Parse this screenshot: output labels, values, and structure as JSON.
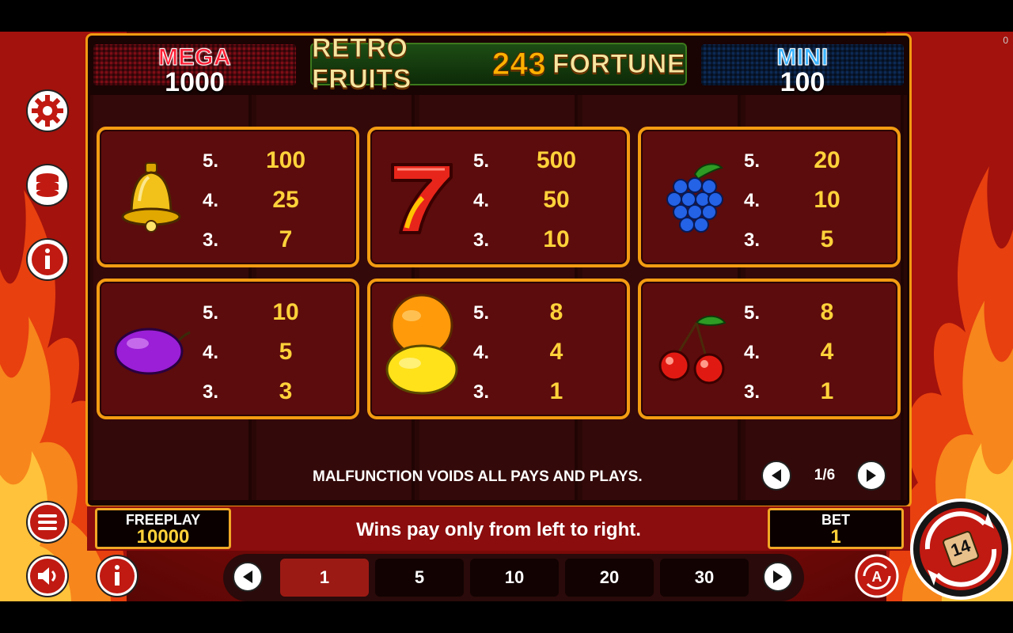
{
  "corner_counter": "0",
  "jackpots": {
    "mega": {
      "label": "MEGA",
      "value": "1000"
    },
    "mini": {
      "label": "MINI",
      "value": "100"
    }
  },
  "logo": {
    "part1": "RETRO FRUITS",
    "number": "243",
    "part2": "FORTUNE"
  },
  "paytable": [
    {
      "symbol": "bell-icon",
      "rows": [
        {
          "count": "5.",
          "pay": "100"
        },
        {
          "count": "4.",
          "pay": "25"
        },
        {
          "count": "3.",
          "pay": "7"
        }
      ]
    },
    {
      "symbol": "seven-icon",
      "rows": [
        {
          "count": "5.",
          "pay": "500"
        },
        {
          "count": "4.",
          "pay": "50"
        },
        {
          "count": "3.",
          "pay": "10"
        }
      ]
    },
    {
      "symbol": "grapes-icon",
      "rows": [
        {
          "count": "5.",
          "pay": "20"
        },
        {
          "count": "4.",
          "pay": "10"
        },
        {
          "count": "3.",
          "pay": "5"
        }
      ]
    },
    {
      "symbol": "plum-icon",
      "rows": [
        {
          "count": "5.",
          "pay": "10"
        },
        {
          "count": "4.",
          "pay": "5"
        },
        {
          "count": "3.",
          "pay": "3"
        }
      ]
    },
    {
      "symbol": "orange-lemon-icon",
      "rows": [
        {
          "count": "5.",
          "pay": "8"
        },
        {
          "count": "4.",
          "pay": "4"
        },
        {
          "count": "3.",
          "pay": "1"
        }
      ]
    },
    {
      "symbol": "cherries-icon",
      "rows": [
        {
          "count": "5.",
          "pay": "8"
        },
        {
          "count": "4.",
          "pay": "4"
        },
        {
          "count": "3.",
          "pay": "1"
        }
      ]
    }
  ],
  "disclaimer": "MALFUNCTION VOIDS ALL PAYS AND PLAYS.",
  "pager": {
    "text": "1/6"
  },
  "freeplay": {
    "label": "FREEPLAY",
    "value": "10000"
  },
  "message": "Wins pay only from left to right.",
  "bet": {
    "label": "BET",
    "value": "1"
  },
  "bet_options": [
    "1",
    "5",
    "10",
    "20",
    "30"
  ],
  "selected_bet": "1",
  "spin_badge": "14",
  "colors": {
    "accent": "#f39c12",
    "payout": "#ffd23a",
    "card": "#5c0c0c",
    "bar": "#8b0d0d"
  }
}
